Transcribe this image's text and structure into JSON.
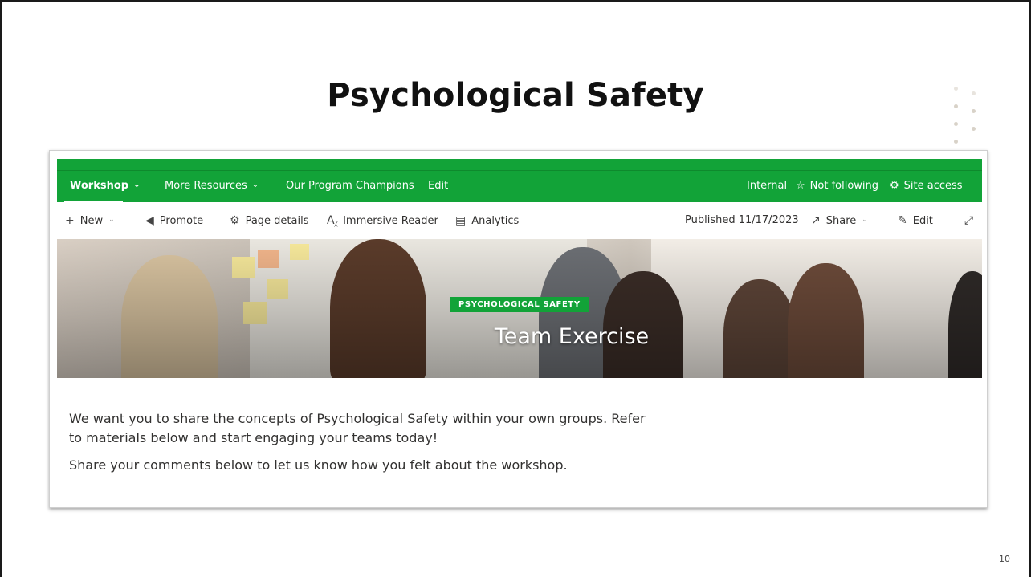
{
  "slide": {
    "title": "Psychological Safety",
    "page_number": "10"
  },
  "navbar": {
    "items": [
      {
        "label": "Workshop",
        "has_dropdown": true,
        "active": true
      },
      {
        "label": "More Resources",
        "has_dropdown": true
      },
      {
        "label": "Our Program Champions"
      },
      {
        "label": "Edit"
      }
    ],
    "right": {
      "internal_label": "Internal",
      "follow_label": "Not following",
      "site_access_label": "Site access"
    }
  },
  "commandbar": {
    "new_label": "New",
    "promote_label": "Promote",
    "page_details_label": "Page details",
    "immersive_reader_label": "Immersive Reader",
    "analytics_label": "Analytics",
    "published_label": "Published 11/17/2023",
    "share_label": "Share",
    "edit_label": "Edit"
  },
  "hero": {
    "tag": "PSYCHOLOGICAL SAFETY",
    "title": "Team Exercise"
  },
  "content": {
    "paragraph_1": "We want you to share the concepts of Psychological Safety within your own groups. Refer to materials below and start engaging your teams today!",
    "paragraph_2": "Share your comments below to let us know how you felt about the workshop."
  },
  "colors": {
    "brand_green": "#12a338",
    "text_dark": "#323130"
  }
}
